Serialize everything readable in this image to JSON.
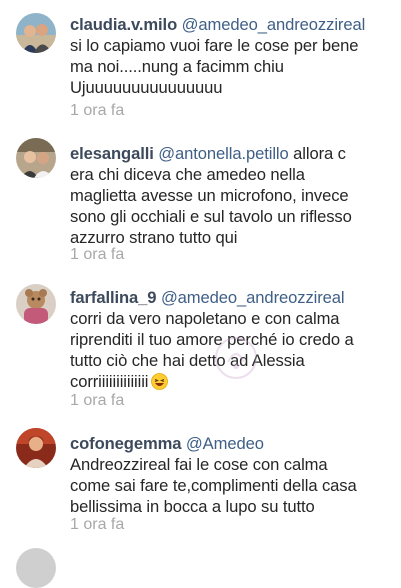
{
  "comments": [
    {
      "username": "claudia.v.milo",
      "mention": "@amedeo_andreozzireal",
      "lines": [
        "si lo capiamo vuoi fare le cose per bene",
        "ma noi.....nung a facimm chiu",
        "Ujuuuuuuuuuuuuuuu"
      ],
      "time": "1 ora fa",
      "avatar_icon": "user-avatar-photo"
    },
    {
      "username": "elesangalli",
      "mention": "@antonella.petillo",
      "head_tail": " allora c",
      "lines": [
        "era chi diceva che amedeo nella",
        "maglietta avesse un microfono, invece",
        "sono gli occhiali e sul tavolo un riflesso",
        "azzurro strano tutto qui"
      ],
      "time": "1 ora fa",
      "avatar_icon": "user-avatar-photo"
    },
    {
      "username": "farfallina_9",
      "mention": "@amedeo_andreozzireal",
      "lines": [
        "corri da vero napoletano e con calma",
        "riprenditi il tuo amore perché io credo a",
        "tutto ciò che hai detto ad Alessia",
        "corriiiiiiiiiiiiii"
      ],
      "emoji": "laughing-emoji",
      "time": "1 ora fa",
      "avatar_icon": "user-avatar-photo"
    },
    {
      "username": "cofonegemma",
      "mention": "@Amedeo",
      "lines": [
        "Andreozzireal fai le cose con calma",
        "come sai fare te,complimenti della casa",
        "bellissima in bocca a lupo su tutto"
      ],
      "time": "1 ora fa",
      "avatar_icon": "user-avatar-photo"
    }
  ],
  "colors": {
    "username": "#3d4a5c",
    "mention": "#3f5f86",
    "timestamp": "#a8a8a8",
    "text": "#262626"
  }
}
